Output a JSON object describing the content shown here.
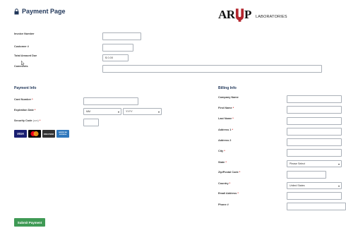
{
  "page": {
    "title": "Payment Page"
  },
  "logo": {
    "text_left": "AR",
    "text_right": "P",
    "labs": "LABORATORIES"
  },
  "invoice": {
    "invoice_number_label": "Invoice Number",
    "customer_label": "Customer #",
    "total_label": "Total Amount Due",
    "total_value": "$ 0.00",
    "comments_label": "Comments"
  },
  "payment": {
    "section_title": "Payment Info",
    "card_number_label": "Card Number",
    "expiration_label": "Expiration Date",
    "month_placeholder": "MM",
    "year_placeholder": "YYYY",
    "security_label": "Security Code",
    "security_note": "(cvv)",
    "req": "*",
    "cards": [
      "VISA",
      "MasterCard",
      "DISCOVER",
      "AMERICAN EXPRESS"
    ]
  },
  "billing": {
    "section_title": "Billing Info",
    "company_label": "Company Name",
    "first_name_label": "First Name",
    "last_name_label": "Last Name",
    "address1_label": "Address 1",
    "address2_label": "Address 2",
    "city_label": "City",
    "state_label": "State",
    "state_value": "Please Select",
    "zip_label": "Zip/Postal Code",
    "country_label": "Country",
    "country_value": "United States",
    "email_label": "Email Address",
    "phone_label": "Phone #"
  },
  "actions": {
    "submit_label": "Submit Payment"
  },
  "colors": {
    "accent": "#1f3558",
    "button": "#3f9a55",
    "logo_red": "#b3262e",
    "required": "#cc0000"
  }
}
